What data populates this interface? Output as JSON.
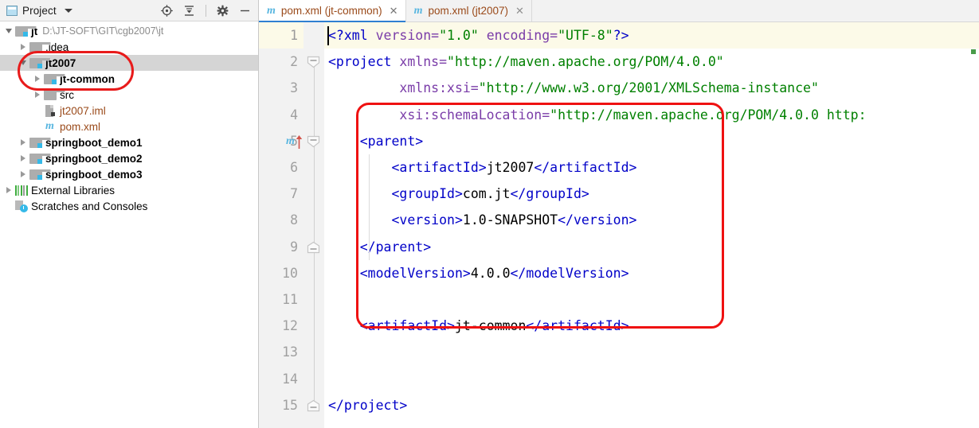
{
  "sidebar": {
    "header": {
      "title": "Project",
      "title_icon": "project-panel-icon",
      "dropdown_icon": "chevron-down-icon",
      "tools": [
        {
          "name": "locate-target-icon",
          "label": "Select Opened File"
        },
        {
          "name": "collapse-all-icon",
          "label": "Collapse All"
        },
        {
          "name": "gear-icon",
          "label": "Settings"
        },
        {
          "name": "minimize-icon",
          "label": "Hide"
        }
      ]
    },
    "tree": [
      {
        "label": "jt",
        "sub": "D:\\JT-SOFT\\GIT\\cgb2007\\jt",
        "icon": "module-folder-icon",
        "twisty": "down",
        "indent": 0,
        "bold": true,
        "selected": false,
        "style": "plain"
      },
      {
        "label": ".idea",
        "sub": "",
        "icon": "folder-icon",
        "twisty": "right",
        "indent": 1,
        "bold": false,
        "selected": false,
        "style": "plain"
      },
      {
        "label": "jt2007",
        "sub": "",
        "icon": "module-folder-icon",
        "twisty": "down",
        "indent": 1,
        "bold": true,
        "selected": true,
        "style": "plain"
      },
      {
        "label": "jt-common",
        "sub": "",
        "icon": "module-folder-icon",
        "twisty": "right",
        "indent": 2,
        "bold": true,
        "selected": false,
        "style": "plain"
      },
      {
        "label": "src",
        "sub": "",
        "icon": "folder-icon",
        "twisty": "right",
        "indent": 2,
        "bold": false,
        "selected": false,
        "style": "plain"
      },
      {
        "label": "jt2007.iml",
        "sub": "",
        "icon": "iml-file-icon",
        "twisty": "none",
        "indent": 2,
        "bold": false,
        "selected": false,
        "style": "file"
      },
      {
        "label": "pom.xml",
        "sub": "",
        "icon": "maven-pom-icon",
        "twisty": "none",
        "indent": 2,
        "bold": false,
        "selected": false,
        "style": "file"
      },
      {
        "label": "springboot_demo1",
        "sub": "",
        "icon": "module-folder-icon",
        "twisty": "right",
        "indent": 1,
        "bold": true,
        "selected": false,
        "style": "plain"
      },
      {
        "label": "springboot_demo2",
        "sub": "",
        "icon": "module-folder-icon",
        "twisty": "right",
        "indent": 1,
        "bold": true,
        "selected": false,
        "style": "plain"
      },
      {
        "label": "springboot_demo3",
        "sub": "",
        "icon": "module-folder-icon",
        "twisty": "right",
        "indent": 1,
        "bold": true,
        "selected": false,
        "style": "plain"
      },
      {
        "label": "External Libraries",
        "sub": "",
        "icon": "external-libraries-icon",
        "twisty": "right",
        "indent": 0,
        "bold": false,
        "selected": false,
        "style": "plain"
      },
      {
        "label": "Scratches and Consoles",
        "sub": "",
        "icon": "scratches-icon",
        "twisty": "none",
        "indent": 0,
        "bold": false,
        "selected": false,
        "style": "plain"
      }
    ]
  },
  "editor": {
    "tabs": [
      {
        "label": "pom.xml (jt-common)",
        "icon": "maven-pom-icon",
        "active": true,
        "close_icon": "close-icon",
        "close_glyph": "✕"
      },
      {
        "label": "pom.xml (jt2007)",
        "icon": "maven-pom-icon",
        "active": false,
        "close_icon": "close-icon",
        "close_glyph": "✕"
      }
    ],
    "line_numbers": [
      "1",
      "2",
      "3",
      "4",
      "5",
      "6",
      "7",
      "8",
      "9",
      "10",
      "11",
      "12",
      "13",
      "14",
      "15"
    ],
    "current_line": 1,
    "gutter_marker": {
      "line": 5,
      "icon": "maven-parent-nav-icon",
      "glyph": "m"
    },
    "lines": [
      {
        "n": 1,
        "segments": [
          {
            "t": "<?xml ",
            "c": "pi"
          },
          {
            "t": "version=",
            "c": "attr"
          },
          {
            "t": "\"1.0\"",
            "c": "val"
          },
          {
            "t": " ",
            "c": "txt"
          },
          {
            "t": "encoding=",
            "c": "attr"
          },
          {
            "t": "\"UTF-8\"",
            "c": "val"
          },
          {
            "t": "?>",
            "c": "pi"
          }
        ]
      },
      {
        "n": 2,
        "segments": [
          {
            "t": "<project ",
            "c": "tag"
          },
          {
            "t": "xmlns=",
            "c": "attr"
          },
          {
            "t": "\"http://maven.apache.org/POM/4.0.0\"",
            "c": "val"
          }
        ]
      },
      {
        "n": 3,
        "segments": [
          {
            "t": "         ",
            "c": "txt"
          },
          {
            "t": "xmlns:xsi=",
            "c": "attr"
          },
          {
            "t": "\"http://www.w3.org/2001/XMLSchema-instance\"",
            "c": "val"
          }
        ]
      },
      {
        "n": 4,
        "segments": [
          {
            "t": "         ",
            "c": "txt"
          },
          {
            "t": "xsi:schemaLocation=",
            "c": "attr"
          },
          {
            "t": "\"http://maven.apache.org/POM/4.0.0 http:",
            "c": "val"
          }
        ]
      },
      {
        "n": 5,
        "segments": [
          {
            "t": "    ",
            "c": "txt"
          },
          {
            "t": "<parent>",
            "c": "tag"
          }
        ]
      },
      {
        "n": 6,
        "segments": [
          {
            "t": "        ",
            "c": "txt"
          },
          {
            "t": "<artifactId>",
            "c": "tag"
          },
          {
            "t": "jt2007",
            "c": "txt"
          },
          {
            "t": "</artifactId>",
            "c": "tag"
          }
        ]
      },
      {
        "n": 7,
        "segments": [
          {
            "t": "        ",
            "c": "txt"
          },
          {
            "t": "<groupId>",
            "c": "tag"
          },
          {
            "t": "com.jt",
            "c": "txt"
          },
          {
            "t": "</groupId>",
            "c": "tag"
          }
        ]
      },
      {
        "n": 8,
        "segments": [
          {
            "t": "        ",
            "c": "txt"
          },
          {
            "t": "<version>",
            "c": "tag"
          },
          {
            "t": "1.0-SNAPSHOT",
            "c": "txt"
          },
          {
            "t": "</version>",
            "c": "tag"
          }
        ]
      },
      {
        "n": 9,
        "segments": [
          {
            "t": "    ",
            "c": "txt"
          },
          {
            "t": "</parent>",
            "c": "tag"
          }
        ]
      },
      {
        "n": 10,
        "segments": [
          {
            "t": "    ",
            "c": "txt"
          },
          {
            "t": "<modelVersion>",
            "c": "tag"
          },
          {
            "t": "4.0.0",
            "c": "txt"
          },
          {
            "t": "</modelVersion>",
            "c": "tag"
          }
        ]
      },
      {
        "n": 11,
        "segments": [
          {
            "t": "",
            "c": "txt"
          }
        ]
      },
      {
        "n": 12,
        "segments": [
          {
            "t": "    ",
            "c": "txt"
          },
          {
            "t": "<artifactId>",
            "c": "tag"
          },
          {
            "t": "jt-common",
            "c": "txt"
          },
          {
            "t": "</artifactId>",
            "c": "tag"
          }
        ]
      },
      {
        "n": 13,
        "segments": [
          {
            "t": "",
            "c": "txt"
          }
        ]
      },
      {
        "n": 14,
        "segments": [
          {
            "t": "",
            "c": "txt"
          }
        ]
      },
      {
        "n": 15,
        "segments": [
          {
            "t": "",
            "c": "txt"
          },
          {
            "t": "</project>",
            "c": "tag"
          }
        ]
      }
    ],
    "fold_markers": [
      {
        "line": 2,
        "type": "open"
      },
      {
        "line": 5,
        "type": "open"
      },
      {
        "line": 9,
        "type": "end"
      },
      {
        "line": 15,
        "type": "end"
      }
    ]
  },
  "annotations": [
    {
      "name": "red-oval-highlight",
      "shape": "oval",
      "target": "jt2007 / jt-common tree rows",
      "color": "#e81b1b"
    },
    {
      "name": "red-rect-highlight",
      "shape": "rounded-rect",
      "target": "parent block lines 5-12",
      "color": "#ef1111"
    }
  ],
  "colors": {
    "tag": "#0000c8",
    "attr": "#7a3ca8",
    "value": "#008000",
    "text": "#000000",
    "annotation_red": "#ef1111",
    "tab_active_underline": "#2f7fd1",
    "file_label": "#9a4a1a",
    "selection": "#d5d5d5",
    "current_line": "#fcfae8"
  }
}
